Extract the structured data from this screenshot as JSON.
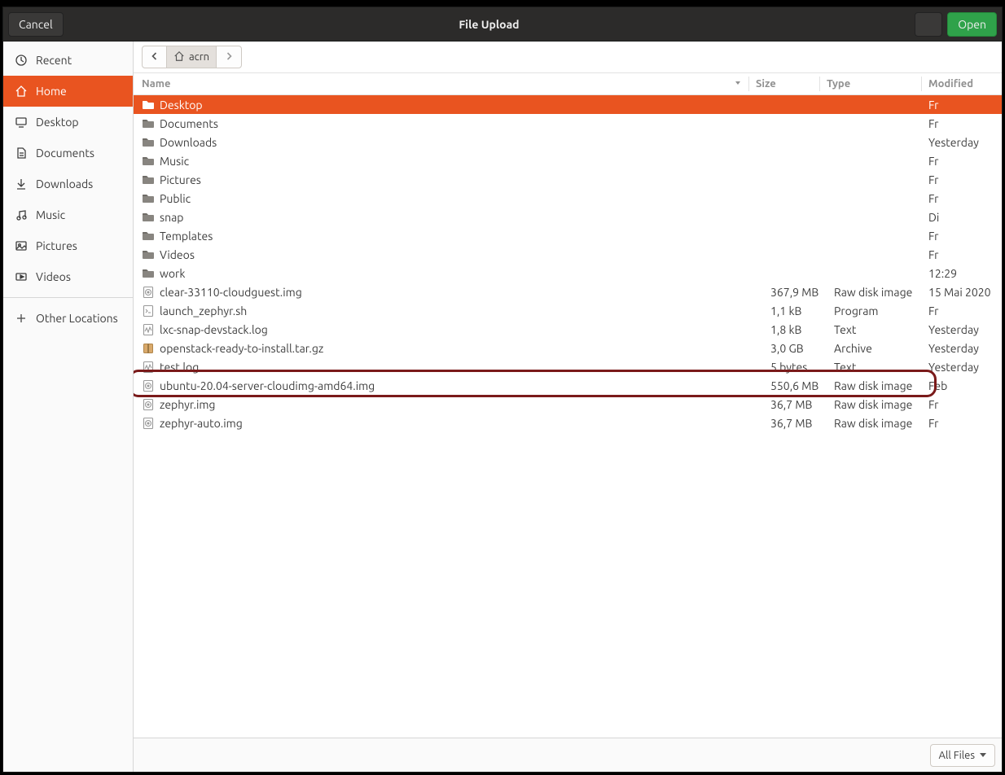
{
  "titlebar": {
    "cancel": "Cancel",
    "title": "File Upload",
    "open": "Open"
  },
  "sidebar": {
    "items": [
      {
        "id": "recent",
        "label": "Recent"
      },
      {
        "id": "home",
        "label": "Home",
        "active": true
      },
      {
        "id": "desktop",
        "label": "Desktop"
      },
      {
        "id": "documents",
        "label": "Documents"
      },
      {
        "id": "downloads",
        "label": "Downloads"
      },
      {
        "id": "music",
        "label": "Music"
      },
      {
        "id": "pictures",
        "label": "Pictures"
      },
      {
        "id": "videos",
        "label": "Videos"
      }
    ],
    "other": "Other Locations"
  },
  "path": {
    "segment": "acrn"
  },
  "columns": {
    "name": "Name",
    "size": "Size",
    "type": "Type",
    "modified": "Modified"
  },
  "rows": [
    {
      "icon": "folder-sel",
      "name": "Desktop",
      "size": "",
      "type": "",
      "mod": "Fr",
      "selected": true
    },
    {
      "icon": "folder",
      "name": "Documents",
      "size": "",
      "type": "",
      "mod": "Fr"
    },
    {
      "icon": "folder",
      "name": "Downloads",
      "size": "",
      "type": "",
      "mod": "Yesterday"
    },
    {
      "icon": "folder",
      "name": "Music",
      "size": "",
      "type": "",
      "mod": "Fr"
    },
    {
      "icon": "folder",
      "name": "Pictures",
      "size": "",
      "type": "",
      "mod": "Fr"
    },
    {
      "icon": "folder",
      "name": "Public",
      "size": "",
      "type": "",
      "mod": "Fr"
    },
    {
      "icon": "folder",
      "name": "snap",
      "size": "",
      "type": "",
      "mod": "Di"
    },
    {
      "icon": "folder",
      "name": "Templates",
      "size": "",
      "type": "",
      "mod": "Fr"
    },
    {
      "icon": "folder",
      "name": "Videos",
      "size": "",
      "type": "",
      "mod": "Fr"
    },
    {
      "icon": "folder",
      "name": "work",
      "size": "",
      "type": "",
      "mod": "12:29"
    },
    {
      "icon": "disk",
      "name": "clear-33110-cloudguest.img",
      "size": "367,9 MB",
      "type": "Raw disk image",
      "mod": "15 Mai 2020"
    },
    {
      "icon": "script",
      "name": "launch_zephyr.sh",
      "size": "1,1 kB",
      "type": "Program",
      "mod": "Fr"
    },
    {
      "icon": "text",
      "name": "lxc-snap-devstack.log",
      "size": "1,8 kB",
      "type": "Text",
      "mod": "Yesterday"
    },
    {
      "icon": "archive",
      "name": "openstack-ready-to-install.tar.gz",
      "size": "3,0 GB",
      "type": "Archive",
      "mod": "Yesterday"
    },
    {
      "icon": "text",
      "name": "test.log",
      "size": "5 bytes",
      "type": "Text",
      "mod": "Yesterday"
    },
    {
      "icon": "disk",
      "name": "ubuntu-20.04-server-cloudimg-amd64.img",
      "size": "550,6 MB",
      "type": "Raw disk image",
      "mod": "Feb",
      "highlight": true
    },
    {
      "icon": "disk",
      "name": "zephyr.img",
      "size": "36,7 MB",
      "type": "Raw disk image",
      "mod": "Fr"
    },
    {
      "icon": "disk",
      "name": "zephyr-auto.img",
      "size": "36,7 MB",
      "type": "Raw disk image",
      "mod": "Fr"
    }
  ],
  "footer": {
    "filter": "All Files"
  }
}
